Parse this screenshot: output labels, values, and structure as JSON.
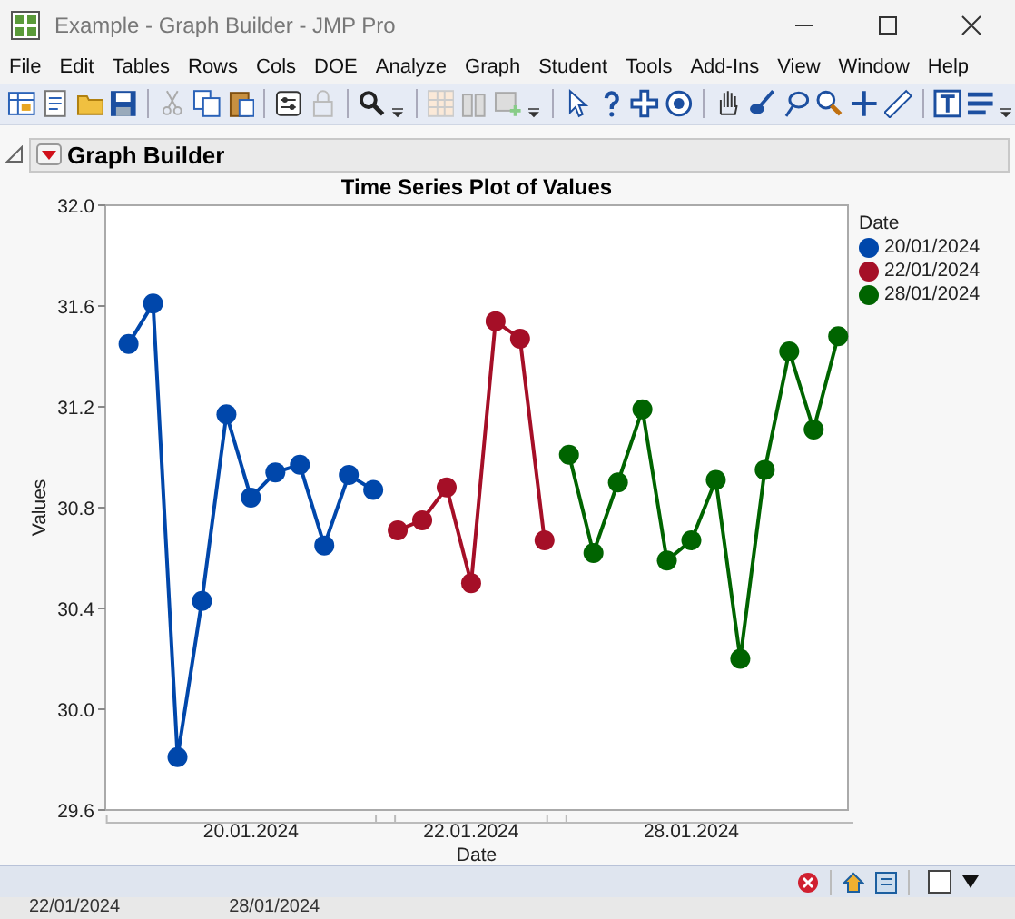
{
  "window": {
    "title": "Example - Graph Builder - JMP Pro"
  },
  "menu": [
    "File",
    "Edit",
    "Tables",
    "Rows",
    "Cols",
    "DOE",
    "Analyze",
    "Graph",
    "Student",
    "Tools",
    "Add-Ins",
    "View",
    "Window",
    "Help"
  ],
  "report": {
    "title": "Graph Builder",
    "expanded": true,
    "graph": {
      "legend_title": "Date",
      "chart_data": {
        "type": "line",
        "title": "Time Series Plot of Values",
        "xlabel": "Date",
        "ylabel": "Values",
        "categories": [
          null,
          null,
          null,
          null,
          null,
          "20.01.2024",
          null,
          null,
          null,
          null,
          null,
          null,
          null,
          null,
          "22.01.2024",
          null,
          null,
          null,
          null,
          null,
          null,
          null,
          null,
          "28.01.2024",
          null,
          null,
          null,
          null,
          null,
          null
        ],
        "ylim": [
          29.6,
          32.0
        ],
        "yticks": [
          {
            "value": 29.6,
            "label": "29.6"
          },
          {
            "value": 30.0,
            "label": "30.0"
          },
          {
            "value": 30.4,
            "label": "30.4"
          },
          {
            "value": 30.8,
            "label": "30.8"
          },
          {
            "value": 31.2,
            "label": "31.2"
          },
          {
            "value": 31.6,
            "label": "31.6"
          },
          {
            "value": 32.0,
            "label": "32.0"
          }
        ],
        "series": [
          {
            "name": "20/01/2024",
            "color": "#0047ab",
            "marker": "circle",
            "values": [
              31.45,
              31.61,
              29.81,
              30.43,
              31.17,
              30.84,
              30.94,
              30.97,
              30.65,
              30.93,
              30.87,
              null,
              null,
              null,
              null,
              null,
              null,
              null,
              null,
              null,
              null,
              null,
              null,
              null,
              null,
              null,
              null,
              null,
              null,
              null
            ]
          },
          {
            "name": "22/01/2024",
            "color": "#a50f27",
            "marker": "circle",
            "values": [
              null,
              null,
              null,
              null,
              null,
              null,
              null,
              null,
              null,
              null,
              null,
              30.71,
              30.75,
              30.88,
              30.5,
              31.54,
              31.47,
              30.67,
              null,
              null,
              null,
              null,
              null,
              null,
              null,
              null,
              null,
              null,
              null,
              null
            ]
          },
          {
            "name": "28/01/2024",
            "color": "#006400",
            "marker": "circle",
            "values": [
              null,
              null,
              null,
              null,
              null,
              null,
              null,
              null,
              null,
              null,
              null,
              null,
              null,
              null,
              null,
              null,
              null,
              null,
              31.01,
              30.62,
              30.9,
              31.19,
              30.59,
              30.67,
              30.91,
              30.2,
              30.95,
              31.42,
              31.11,
              31.48
            ]
          }
        ]
      }
    }
  },
  "background_texts": [
    "22/01/2024",
    "28/01/2024"
  ]
}
